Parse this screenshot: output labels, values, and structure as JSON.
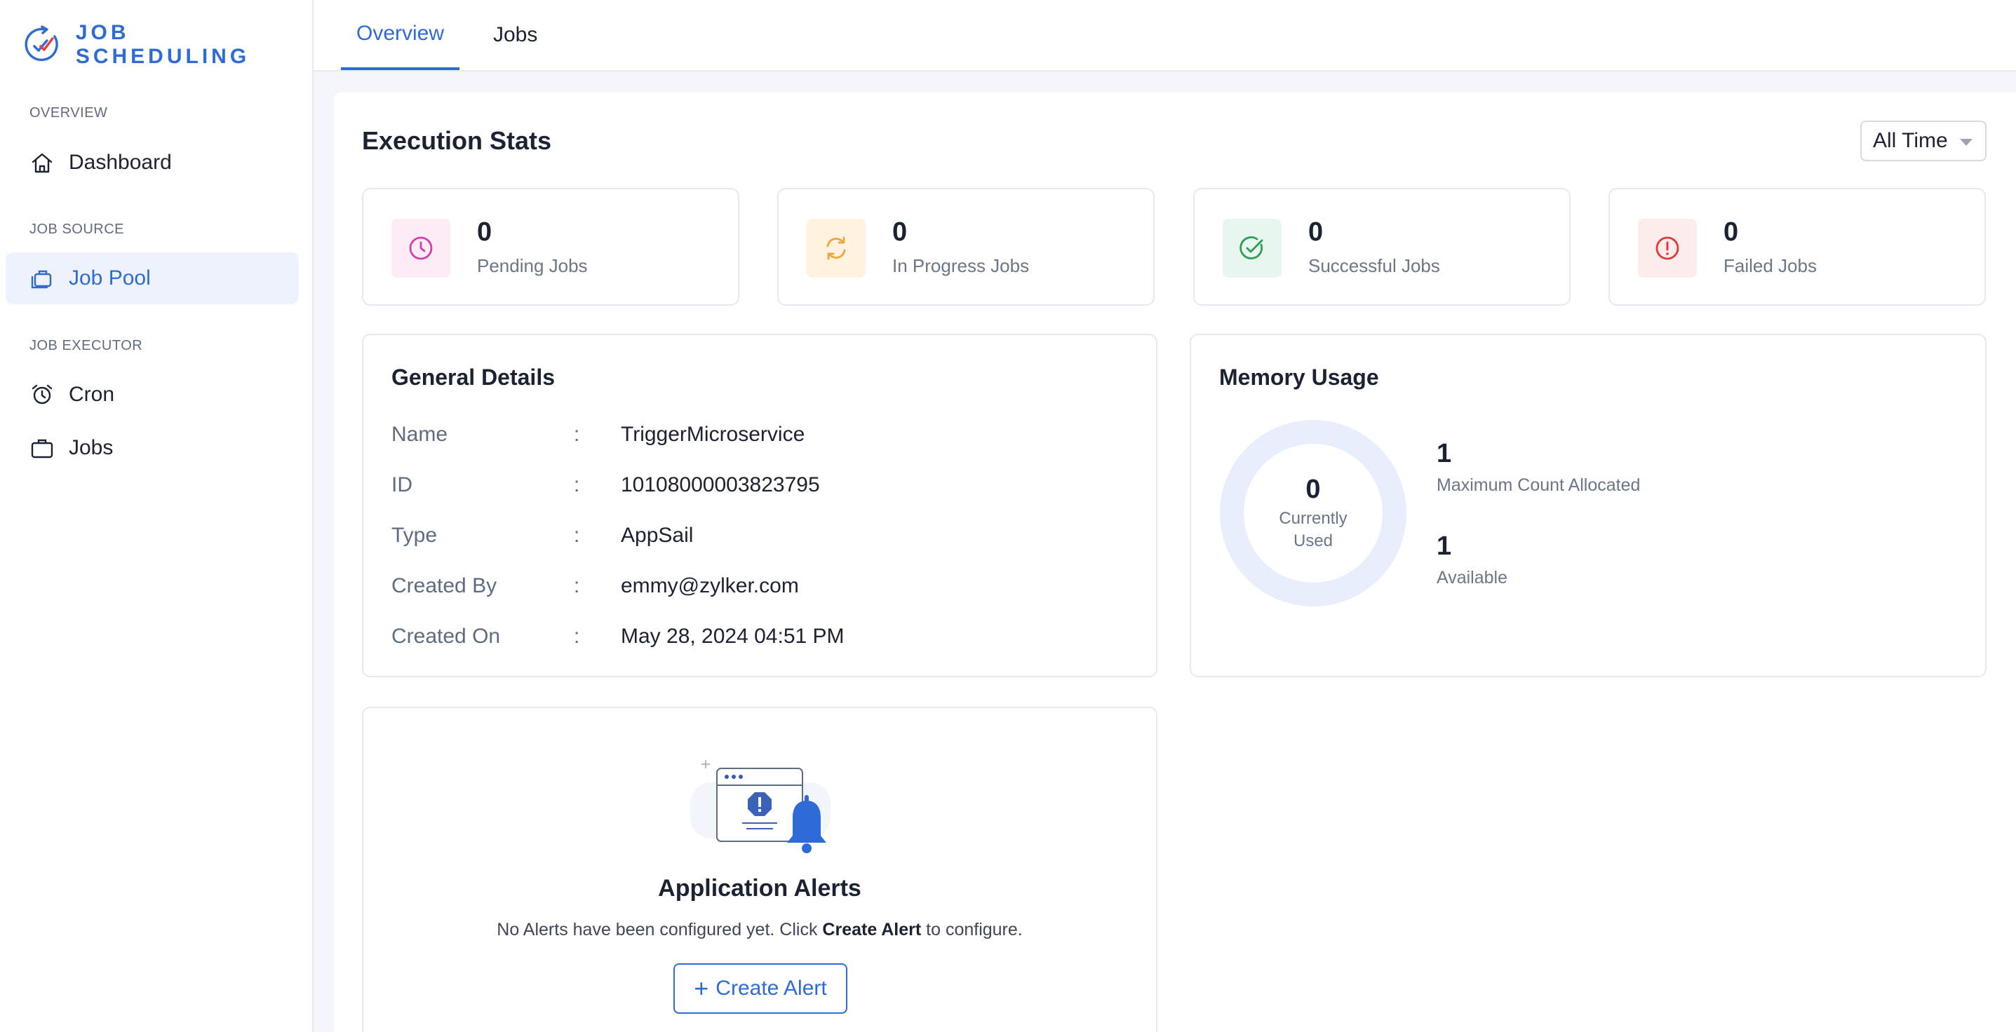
{
  "brand": {
    "name": "JOB SCHEDULING"
  },
  "sidebar": {
    "sections": [
      {
        "title": "OVERVIEW",
        "items": [
          {
            "label": "Dashboard",
            "icon": "home-icon",
            "active": false
          }
        ]
      },
      {
        "title": "JOB SOURCE",
        "items": [
          {
            "label": "Job Pool",
            "icon": "briefcase-stack-icon",
            "active": true
          }
        ]
      },
      {
        "title": "JOB EXECUTOR",
        "items": [
          {
            "label": "Cron",
            "icon": "alarm-clock-icon",
            "active": false
          },
          {
            "label": "Jobs",
            "icon": "briefcase-icon",
            "active": false
          }
        ]
      }
    ]
  },
  "tabs": [
    {
      "label": "Overview",
      "active": true
    },
    {
      "label": "Jobs",
      "active": false
    }
  ],
  "execution_stats": {
    "title": "Execution Stats",
    "filter": {
      "selected": "All Time"
    },
    "stats": [
      {
        "value": "0",
        "label": "Pending Jobs",
        "icon": "clock-icon",
        "color": "#d63fa8",
        "bg": "#fdebf6"
      },
      {
        "value": "0",
        "label": "In Progress Jobs",
        "icon": "refresh-icon",
        "color": "#f0a53a",
        "bg": "#fff3e0"
      },
      {
        "value": "0",
        "label": "Successful Jobs",
        "icon": "check-circle-icon",
        "color": "#2e9e5b",
        "bg": "#e8f7ee"
      },
      {
        "value": "0",
        "label": "Failed Jobs",
        "icon": "alert-circle-icon",
        "color": "#d93b3b",
        "bg": "#fdecec"
      }
    ]
  },
  "general_details": {
    "title": "General Details",
    "separator": ":",
    "rows": [
      {
        "key": "Name",
        "value": "TriggerMicroservice"
      },
      {
        "key": "ID",
        "value": "10108000003823795"
      },
      {
        "key": "Type",
        "value": "AppSail"
      },
      {
        "key": "Created By",
        "value": "emmy@zylker.com"
      },
      {
        "key": "Created On",
        "value": "May 28, 2024 04:51 PM"
      }
    ]
  },
  "memory_usage": {
    "title": "Memory Usage",
    "current": {
      "value": "0",
      "label": "Currently Used"
    },
    "maximum": {
      "value": "1",
      "label": "Maximum Count Allocated"
    },
    "available": {
      "value": "1",
      "label": "Available"
    },
    "ring_color": "#e8eefb"
  },
  "alerts": {
    "title": "Application Alerts",
    "text_before": "No Alerts have been configured yet. Click ",
    "text_bold": "Create Alert",
    "text_after": " to configure.",
    "button_label": "Create Alert"
  },
  "colors": {
    "accent": "#2f6bd6"
  }
}
